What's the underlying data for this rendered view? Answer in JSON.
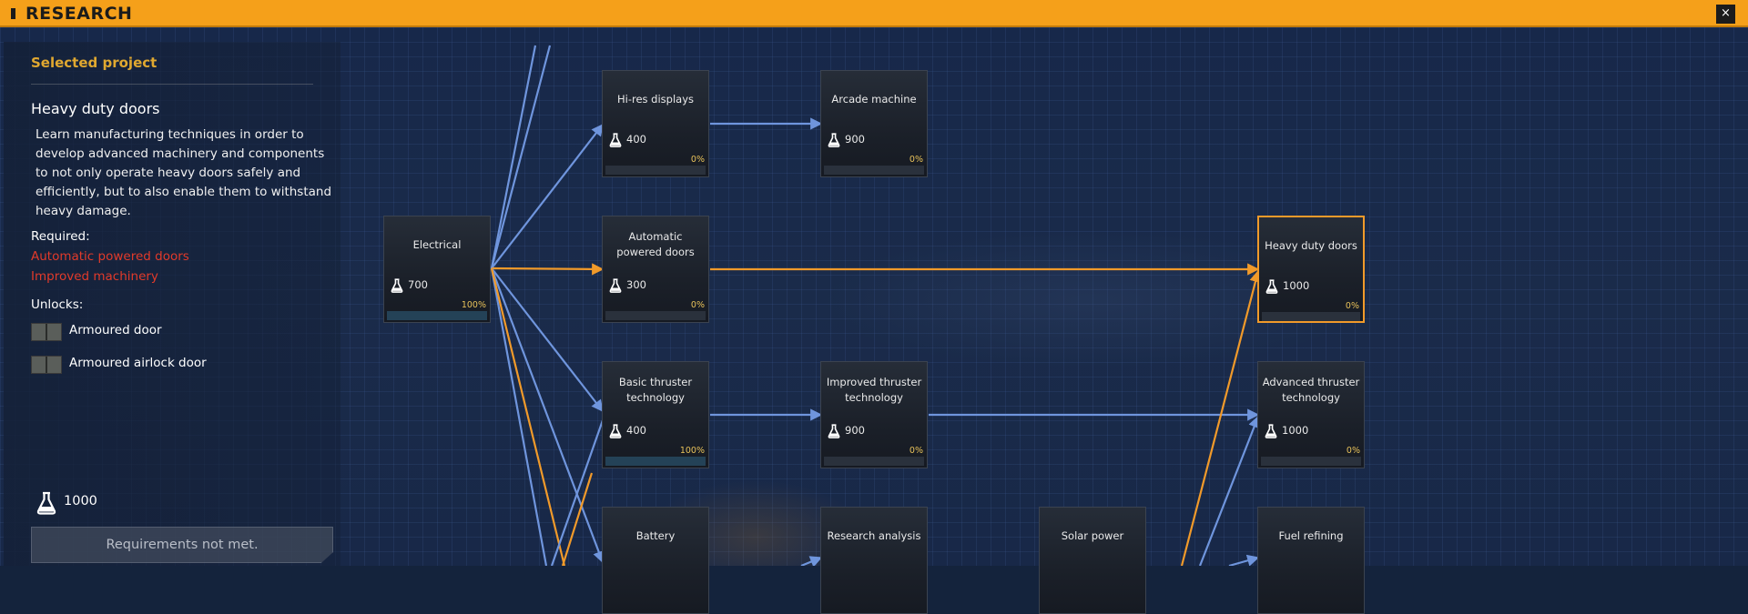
{
  "window": {
    "title": "RESEARCH",
    "close_label": "×"
  },
  "panel": {
    "section_label": "Selected project",
    "project_name": "Heavy duty doors",
    "description": "Learn manufacturing techniques in order to develop advanced machinery and components to not only operate heavy doors safely and efficiently, but to also enable them to withstand heavy damage.",
    "required_label": "Required:",
    "required": [
      "Automatic powered doors",
      "Improved machinery"
    ],
    "unlocks_label": "Unlocks:",
    "unlocks": [
      "Armoured door",
      "Armoured airlock door"
    ],
    "cost": "1000",
    "action_button": "Requirements not met."
  },
  "colors": {
    "accent": "#f5a01a",
    "link_available": "#6f95dd",
    "link_required": "#f19a2a",
    "required_text": "#e23a2a"
  },
  "icons": {
    "cost": "flask-icon",
    "close": "close-icon"
  },
  "nodes": [
    {
      "id": "electrical",
      "title": "Electrical",
      "cost": "700",
      "percent": "100%",
      "progress": 1.0
    },
    {
      "id": "hires",
      "title": "Hi-res displays",
      "cost": "400",
      "percent": "0%",
      "progress": 0
    },
    {
      "id": "arcade",
      "title": "Arcade machine",
      "cost": "900",
      "percent": "0%",
      "progress": 0
    },
    {
      "id": "autodoors",
      "title": "Automatic powered doors",
      "cost": "300",
      "percent": "0%",
      "progress": 0
    },
    {
      "id": "heavydoors",
      "title": "Heavy duty doors",
      "cost": "1000",
      "percent": "0%",
      "progress": 0,
      "selected": true
    },
    {
      "id": "basicthruster",
      "title": "Basic thruster technology",
      "cost": "400",
      "percent": "100%",
      "progress": 1.0
    },
    {
      "id": "improvedthruster",
      "title": "Improved thruster technology",
      "cost": "900",
      "percent": "0%",
      "progress": 0
    },
    {
      "id": "advthruster",
      "title": "Advanced thruster technology",
      "cost": "1000",
      "percent": "0%",
      "progress": 0
    },
    {
      "id": "battery",
      "title": "Battery"
    },
    {
      "id": "research",
      "title": "Research analysis"
    },
    {
      "id": "solar",
      "title": "Solar power"
    },
    {
      "id": "fuel",
      "title": "Fuel refining"
    }
  ]
}
